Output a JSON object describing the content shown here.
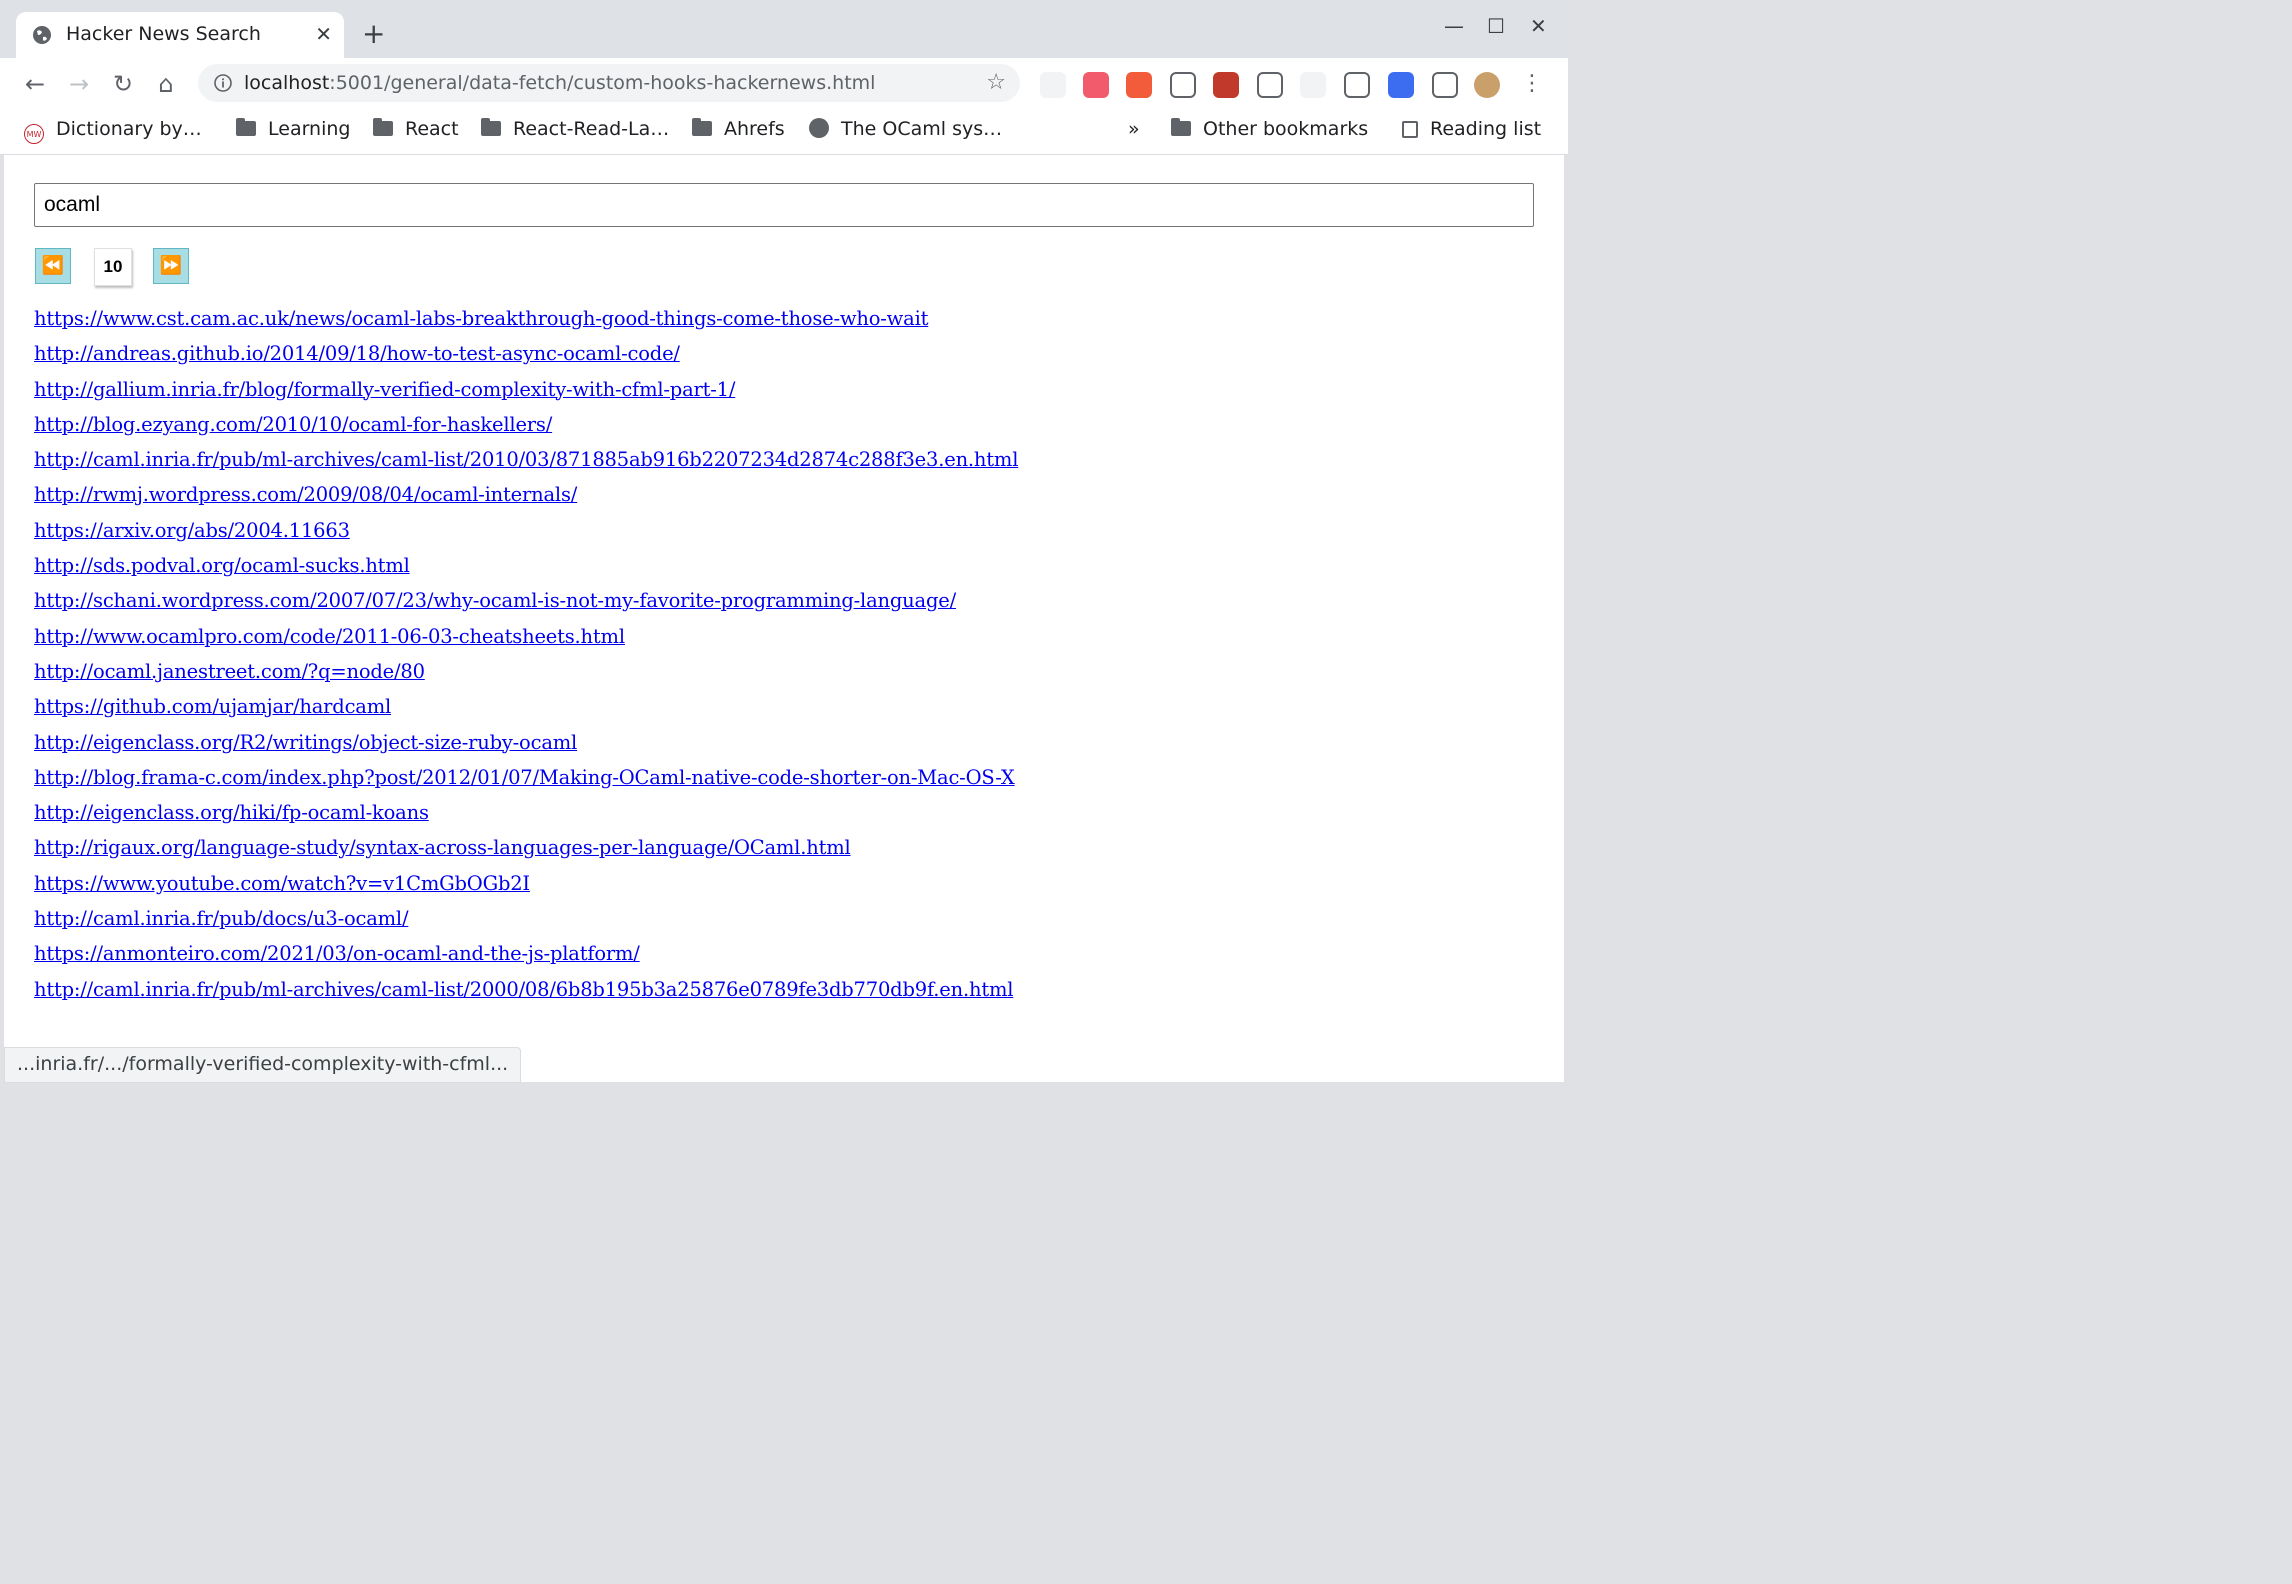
{
  "tab": {
    "title": "Hacker News Search",
    "close": "✕",
    "new_tab": "+"
  },
  "window_controls": {
    "minimize": "—",
    "maximize": "☐",
    "close": "✕"
  },
  "nav": {
    "back": "←",
    "forward": "→",
    "reload": "↻",
    "home": "⌂"
  },
  "omnibox": {
    "host": "localhost",
    "rest": ":5001/general/data-fetch/custom-hooks-hackernews.html",
    "star": "☆"
  },
  "extensions": [
    "#f1f3f4",
    "#f15b6c",
    "#f25c3a",
    "#ffffff",
    "#c0392b",
    "#ffffff",
    "#f1f3f4",
    "#ffffff",
    "#3c6cf0",
    "#ffffff",
    "#c9a06a"
  ],
  "bookmarks": {
    "items": [
      "Dictionary by…",
      "Learning",
      "React",
      "React-Read-La…",
      "Ahrefs",
      "The OCaml sys…"
    ],
    "overflow": "»",
    "other": "Other bookmarks",
    "reading_list": "Reading list"
  },
  "search": {
    "value": "ocaml"
  },
  "pagination": {
    "prev": "⏪",
    "page": "10",
    "next": "⏩"
  },
  "results": [
    "https://www.cst.cam.ac.uk/news/ocaml-labs-breakthrough-good-things-come-those-who-wait",
    "http://andreas.github.io/2014/09/18/how-to-test-async-ocaml-code/",
    "http://gallium.inria.fr/blog/formally-verified-complexity-with-cfml-part-1/",
    "http://blog.ezyang.com/2010/10/ocaml-for-haskellers/",
    "http://caml.inria.fr/pub/ml-archives/caml-list/2010/03/871885ab916b2207234d2874c288f3e3.en.html",
    "http://rwmj.wordpress.com/2009/08/04/ocaml-internals/",
    "https://arxiv.org/abs/2004.11663",
    "http://sds.podval.org/ocaml-sucks.html",
    "http://schani.wordpress.com/2007/07/23/why-ocaml-is-not-my-favorite-programming-language/",
    "http://www.ocamlpro.com/code/2011-06-03-cheatsheets.html",
    "http://ocaml.janestreet.com/?q=node/80",
    "https://github.com/ujamjar/hardcaml",
    "http://eigenclass.org/R2/writings/object-size-ruby-ocaml",
    "http://blog.frama-c.com/index.php?post/2012/01/07/Making-OCaml-native-code-shorter-on-Mac-OS-X",
    "http://eigenclass.org/hiki/fp-ocaml-koans",
    "http://rigaux.org/language-study/syntax-across-languages-per-language/OCaml.html",
    "https://www.youtube.com/watch?v=v1CmGbOGb2I",
    "http://caml.inria.fr/pub/docs/u3-ocaml/",
    "https://anmonteiro.com/2021/03/on-ocaml-and-the-js-platform/",
    "http://caml.inria.fr/pub/ml-archives/caml-list/2000/08/6b8b195b3a25876e0789fe3db770db9f.en.html"
  ],
  "status": "...inria.fr/.../formally-verified-complexity-with-cfml..."
}
